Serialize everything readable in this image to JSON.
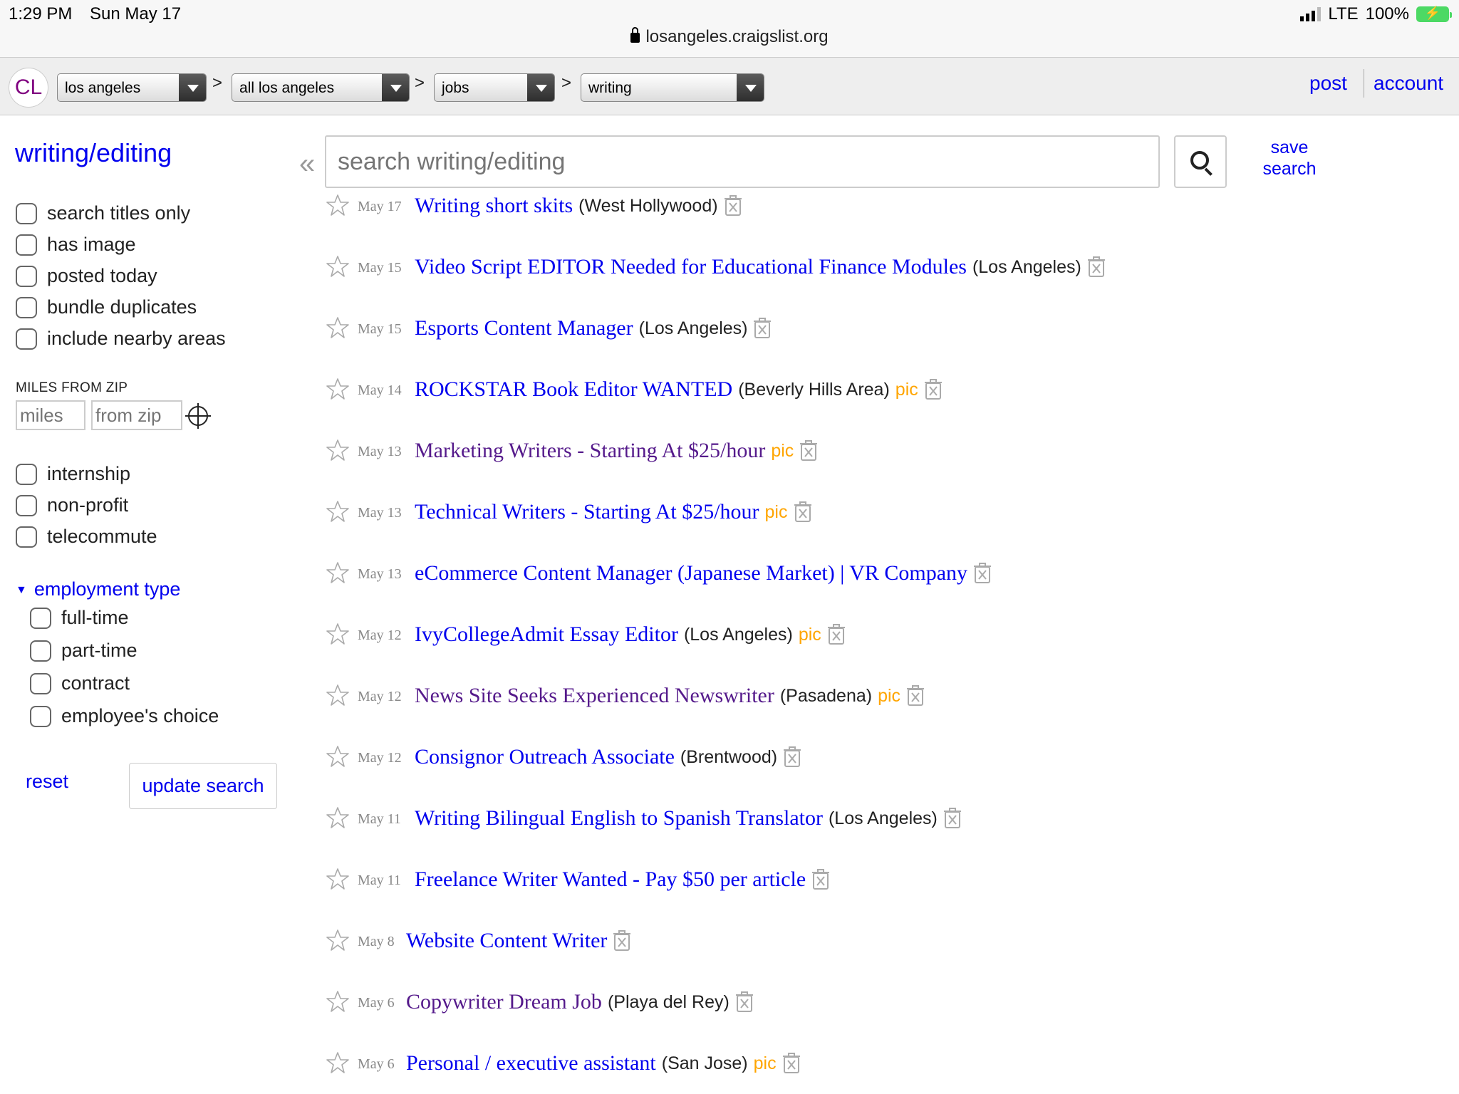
{
  "status": {
    "time": "1:29 PM",
    "date": "Sun May 17",
    "carrier": "LTE",
    "battery": "100%"
  },
  "url": "losangeles.craigslist.org",
  "header": {
    "logo": "CL",
    "crumbs": [
      "los angeles",
      "all los angeles",
      "jobs",
      "writing"
    ],
    "separator": ">",
    "post": "post",
    "account": "account"
  },
  "sidebar": {
    "title": "writing/editing",
    "filters": [
      "search titles only",
      "has image",
      "posted today",
      "bundle duplicates",
      "include nearby areas"
    ],
    "miles_label": "MILES FROM ZIP",
    "miles_placeholder": "miles",
    "zip_placeholder": "from zip",
    "extra_filters": [
      "internship",
      "non-profit",
      "telecommute"
    ],
    "employment_label": "employment type",
    "employment_types": [
      "full-time",
      "part-time",
      "contract",
      "employee's choice"
    ],
    "reset": "reset",
    "update": "update search"
  },
  "search": {
    "collapse": "«",
    "placeholder": "search writing/editing",
    "save": "save search"
  },
  "icons": {
    "star": "star-icon",
    "trash": "hide-icon",
    "search": "search-icon",
    "target": "location-target-icon"
  },
  "colors": {
    "link": "#0000ee",
    "visited": "#551a8b",
    "pic": "#ffa500"
  },
  "results": [
    {
      "date": "May 17",
      "title": "Writing short skits",
      "location": "(West Hollywood)",
      "pic": "",
      "visited": false
    },
    {
      "date": "May 15",
      "title": "Video Script EDITOR Needed for Educational Finance Modules",
      "location": "(Los Angeles)",
      "pic": "",
      "visited": false
    },
    {
      "date": "May 15",
      "title": "Esports Content Manager",
      "location": "(Los Angeles)",
      "pic": "",
      "visited": false
    },
    {
      "date": "May 14",
      "title": "ROCKSTAR Book Editor WANTED",
      "location": "(Beverly Hills Area)",
      "pic": "pic",
      "visited": false
    },
    {
      "date": "May 13",
      "title": "Marketing Writers - Starting At $25/hour",
      "location": "",
      "pic": "pic",
      "visited": true
    },
    {
      "date": "May 13",
      "title": "Technical Writers - Starting At $25/hour",
      "location": "",
      "pic": "pic",
      "visited": false
    },
    {
      "date": "May 13",
      "title": "eCommerce Content Manager (Japanese Market) | VR Company",
      "location": "",
      "pic": "",
      "visited": false
    },
    {
      "date": "May 12",
      "title": "IvyCollegeAdmit Essay Editor",
      "location": "(Los Angeles)",
      "pic": "pic",
      "visited": false
    },
    {
      "date": "May 12",
      "title": "News Site Seeks Experienced Newswriter",
      "location": "(Pasadena)",
      "pic": "pic",
      "visited": true
    },
    {
      "date": "May 12",
      "title": "Consignor Outreach Associate",
      "location": "(Brentwood)",
      "pic": "",
      "visited": false
    },
    {
      "date": "May 11",
      "title": "Writing Bilingual English to Spanish Translator",
      "location": "(Los Angeles)",
      "pic": "",
      "visited": false
    },
    {
      "date": "May 11",
      "title": "Freelance Writer Wanted - Pay $50 per article",
      "location": "",
      "pic": "",
      "visited": false
    },
    {
      "date": "May 8",
      "title": "Website Content Writer",
      "location": "",
      "pic": "",
      "visited": false
    },
    {
      "date": "May 6",
      "title": "Copywriter Dream Job",
      "location": "(Playa del Rey)",
      "pic": "",
      "visited": true
    },
    {
      "date": "May 6",
      "title": "Personal / executive assistant",
      "location": "(San Jose)",
      "pic": "pic",
      "visited": false
    }
  ]
}
